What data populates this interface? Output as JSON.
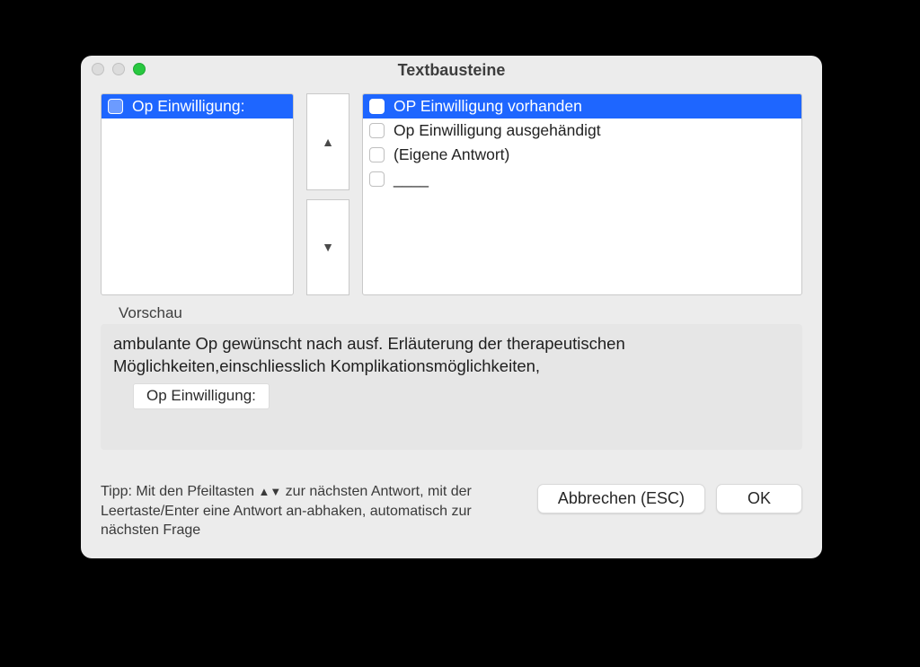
{
  "window": {
    "title": "Textbausteine"
  },
  "leftList": {
    "items": [
      {
        "label": "Op Einwilligung:",
        "selected": true
      }
    ]
  },
  "arrows": {
    "up": "▲",
    "down": "▼"
  },
  "rightList": {
    "items": [
      {
        "label": "OP Einwilligung vorhanden",
        "selected": true
      },
      {
        "label": "Op Einwilligung ausgehändigt",
        "selected": false
      },
      {
        "label": "(Eigene Antwort)",
        "selected": false
      },
      {
        "label": "____",
        "selected": false
      }
    ]
  },
  "preview": {
    "label": "Vorschau",
    "text": "ambulante Op gewünscht nach ausf. Erläuterung der therapeutischen Möglichkeiten,einschliesslich Komplikationsmöglichkeiten,",
    "chip": "Op Einwilligung:"
  },
  "footer": {
    "tip_pre": "Tipp: Mit den Pfeiltasten ",
    "tip_arrows": "▲▼",
    "tip_post": " zur nächsten Antwort, mit der Leertaste/Enter eine Antwort an-abhaken, automatisch zur nächsten Frage",
    "cancel": "Abbrechen (ESC)",
    "ok": "OK"
  }
}
